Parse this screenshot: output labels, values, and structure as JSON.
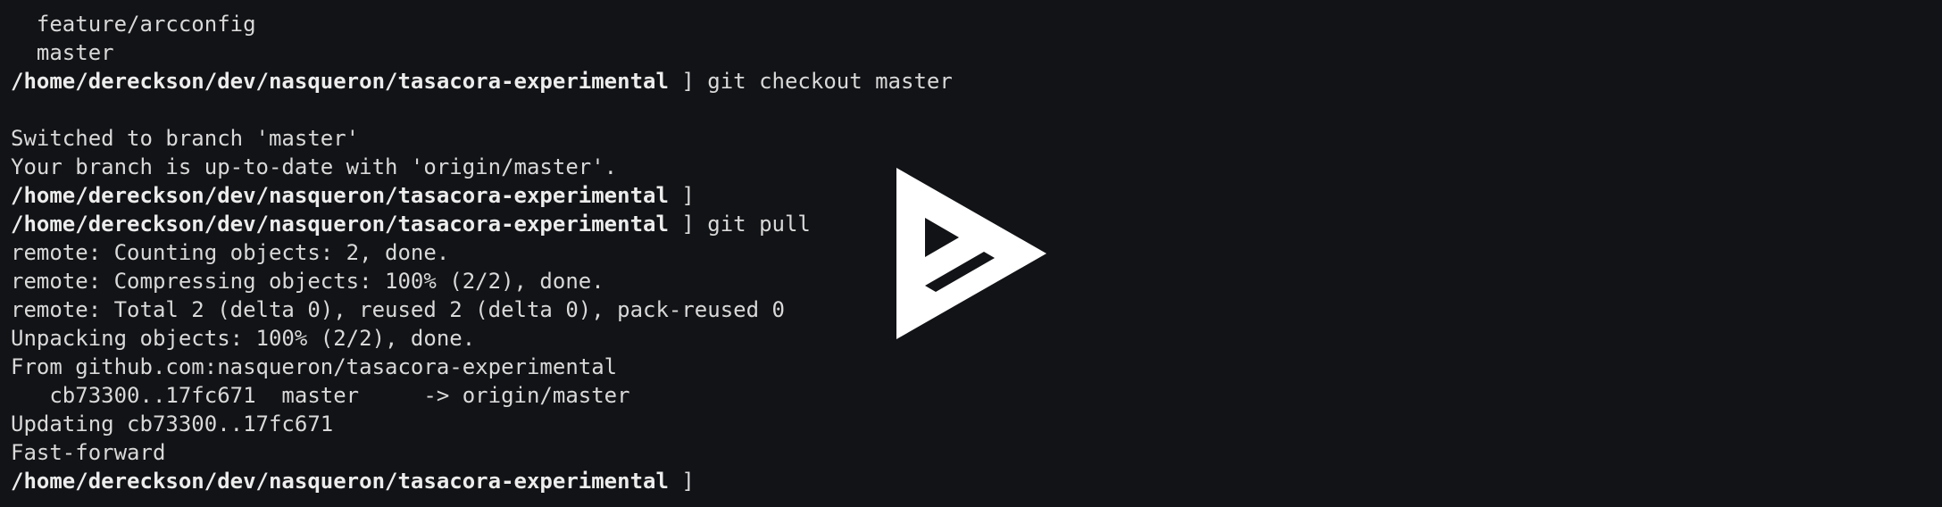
{
  "terminal": {
    "lines": [
      {
        "kind": "output",
        "text": "  feature/arcconfig"
      },
      {
        "kind": "output",
        "text": "  master"
      },
      {
        "kind": "prompt",
        "path": "/home/dereckson/dev/nasqueron/tasacora-experimental",
        "suffix": " ] git checkout master"
      },
      {
        "kind": "output",
        "text": ""
      },
      {
        "kind": "output",
        "text": "Switched to branch 'master'"
      },
      {
        "kind": "output",
        "text": "Your branch is up-to-date with 'origin/master'."
      },
      {
        "kind": "prompt",
        "path": "/home/dereckson/dev/nasqueron/tasacora-experimental",
        "suffix": " ]"
      },
      {
        "kind": "prompt",
        "path": "/home/dereckson/dev/nasqueron/tasacora-experimental",
        "suffix": " ] git pull"
      },
      {
        "kind": "output",
        "text": "remote: Counting objects: 2, done."
      },
      {
        "kind": "output",
        "text": "remote: Compressing objects: 100% (2/2), done."
      },
      {
        "kind": "output",
        "text": "remote: Total 2 (delta 0), reused 2 (delta 0), pack-reused 0"
      },
      {
        "kind": "output",
        "text": "Unpacking objects: 100% (2/2), done."
      },
      {
        "kind": "output",
        "text": "From github.com:nasqueron/tasacora-experimental"
      },
      {
        "kind": "output",
        "text": "   cb73300..17fc671  master     -> origin/master"
      },
      {
        "kind": "output",
        "text": "Updating cb73300..17fc671"
      },
      {
        "kind": "output",
        "text": "Fast-forward"
      },
      {
        "kind": "prompt",
        "path": "/home/dereckson/dev/nasqueron/tasacora-experimental",
        "suffix": " ]"
      }
    ]
  },
  "overlay": {
    "icon": "asciinema-play-logo-icon",
    "color": "#ffffff"
  },
  "colors": {
    "background": "#121316",
    "foreground": "#d9d9d9"
  }
}
